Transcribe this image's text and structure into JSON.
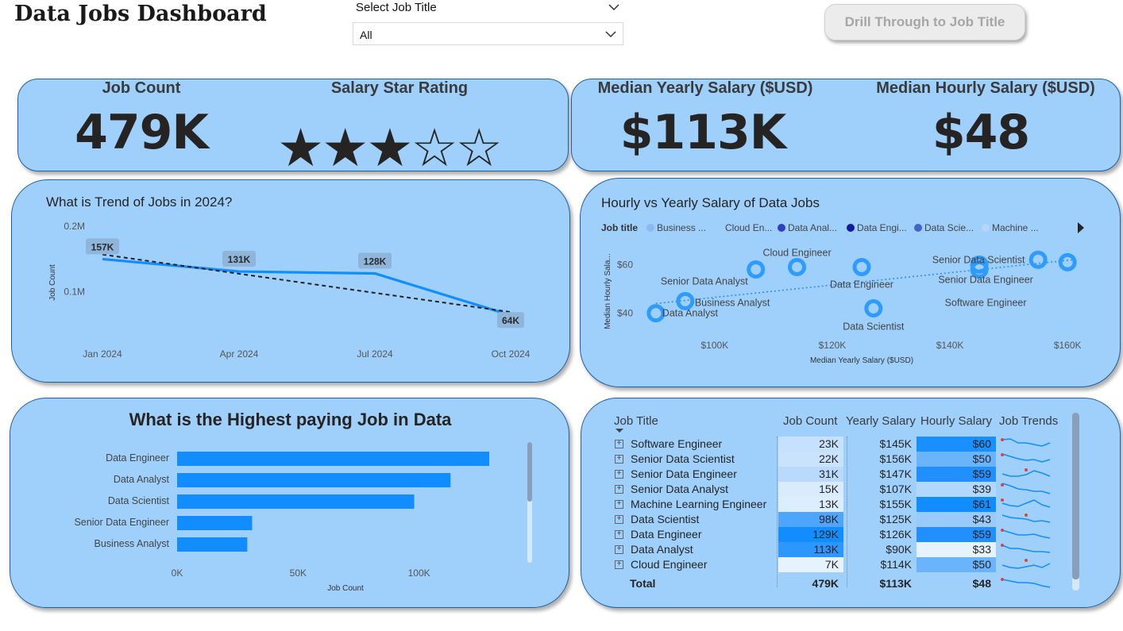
{
  "page": {
    "title": "Data Jobs Dashboard"
  },
  "slicer": {
    "label": "Select Job Title",
    "value": "All"
  },
  "drill_button": {
    "label": "Drill Through to Job Title"
  },
  "kpis": {
    "job_count": {
      "label": "Job Count",
      "value": "479K"
    },
    "star_rating": {
      "label": "Salary Star Rating",
      "stars": "★★★☆☆",
      "rating": 3,
      "max": 5
    },
    "median_yearly": {
      "label": "Median Yearly Salary ($USD)",
      "value": "$113K"
    },
    "median_hourly": {
      "label": "Median Hourly Salary ($USD)",
      "value": "$48"
    }
  },
  "trend_card": {
    "title": "What is Trend of Jobs in 2024?"
  },
  "scatter_card": {
    "title": "Hourly vs Yearly Salary of Data Jobs"
  },
  "bar_card": {
    "title": "What is the Highest paying Job in Data"
  },
  "chart_data": [
    {
      "type": "line",
      "x": [
        "Jan 2024",
        "Apr 2024",
        "Jul 2024",
        "Oct 2024"
      ],
      "series": [
        {
          "values": [
            150,
            131,
            128,
            64
          ]
        }
      ],
      "data_labels": [
        "157K",
        "131K",
        "128K",
        "64K"
      ],
      "trend_line": {
        "start": 157,
        "end": 69,
        "style": "dashed"
      },
      "ylabel": "Job Count",
      "yticks": [
        {
          "v": 200,
          "label": "0.2M"
        },
        {
          "v": 100,
          "label": "0.1M"
        }
      ],
      "ylim": [
        40,
        210
      ],
      "color": "#118dff"
    },
    {
      "type": "scatter",
      "legend_title": "Job title",
      "legend": [
        {
          "name": "Business ...",
          "color": "#8fb8f2"
        },
        {
          "name": "Cloud En...",
          "color": "#9fd0fb"
        },
        {
          "name": "Data Anal...",
          "color": "#2e3fc2"
        },
        {
          "name": "Data Engi...",
          "color": "#0d1aa3"
        },
        {
          "name": "Data Scie...",
          "color": "#4661c9"
        },
        {
          "name": "Machine ...",
          "color": "#b6d6f7"
        }
      ],
      "points": [
        {
          "name": "Data Analyst",
          "x": 90,
          "y": 40
        },
        {
          "name": "Business Analyst",
          "x": 95,
          "y": 45
        },
        {
          "name": "Senior Data Analyst",
          "x": 107,
          "y": 58
        },
        {
          "name": "Cloud Engineer",
          "x": 114,
          "y": 59
        },
        {
          "name": "Data Engineer",
          "x": 125,
          "y": 59
        },
        {
          "name": "Data Scientist",
          "x": 127,
          "y": 42
        },
        {
          "name": "Software Engineer",
          "x": 145,
          "y": 58
        },
        {
          "name": "Senior Data Engineer",
          "x": 145,
          "y": 60
        },
        {
          "name": "Senior Data Scientist",
          "x": 155,
          "y": 62
        },
        {
          "name": "",
          "x": 160,
          "y": 61
        }
      ],
      "trend_line": {
        "from": [
          90,
          44
        ],
        "to": [
          161,
          62
        ],
        "style": "dotted"
      },
      "xlabel": "Median Yearly Salary ($USD)",
      "ylabel": "Median Hourly Sala...",
      "xticks": [
        {
          "v": 100,
          "label": "$100K"
        },
        {
          "v": 120,
          "label": "$120K"
        },
        {
          "v": 140,
          "label": "$140K"
        },
        {
          "v": 160,
          "label": "$160K"
        }
      ],
      "yticks": [
        {
          "v": 60,
          "label": "$60"
        },
        {
          "v": 40,
          "label": "$40"
        }
      ],
      "xlim": [
        88,
        162
      ],
      "ylim": [
        35,
        66
      ]
    },
    {
      "type": "bar",
      "orientation": "horizontal",
      "categories": [
        "Data Engineer",
        "Data Analyst",
        "Data Scientist",
        "Senior Data Engineer",
        "Business Analyst"
      ],
      "values": [
        129,
        113,
        98,
        31,
        29
      ],
      "xlabel": "Job Count",
      "xticks": [
        {
          "v": 0,
          "label": "0K"
        },
        {
          "v": 50,
          "label": "50K"
        },
        {
          "v": 100,
          "label": "100K"
        }
      ],
      "xlim": [
        0,
        140
      ],
      "color": "#118dff"
    }
  ],
  "table": {
    "columns": [
      "Job Title",
      "Job Count",
      "Yearly Salary",
      "Hourly Salary",
      "Job Trends"
    ],
    "rows": [
      {
        "title": "Software Engineer",
        "count": "23K",
        "yearly": "$145K",
        "hourly": "$60",
        "countBg": "#c6e1fd",
        "hourlyBg": "#1a8fff"
      },
      {
        "title": "Senior Data Scientist",
        "count": "22K",
        "yearly": "$156K",
        "hourly": "$50",
        "countBg": "#c9e3fd",
        "hourlyBg": "#6ab4fc"
      },
      {
        "title": "Senior Data Engineer",
        "count": "31K",
        "yearly": "$147K",
        "hourly": "$59",
        "countBg": "#b9dafd",
        "hourlyBg": "#228fff"
      },
      {
        "title": "Senior Data Analyst",
        "count": "15K",
        "yearly": "$107K",
        "hourly": "$39",
        "countBg": "#d9ebfd",
        "hourlyBg": "#b3d8fd"
      },
      {
        "title": "Machine Learning Engineer",
        "count": "13K",
        "yearly": "$155K",
        "hourly": "$61",
        "countBg": "#dcedfd",
        "hourlyBg": "#118dff"
      },
      {
        "title": "Data Scientist",
        "count": "98K",
        "yearly": "$125K",
        "hourly": "$43",
        "countBg": "#4ea5fd",
        "hourlyBg": "#98cbfc"
      },
      {
        "title": "Data Engineer",
        "count": "129K",
        "yearly": "$126K",
        "hourly": "$59",
        "countBg": "#118dff",
        "hourlyBg": "#228fff"
      },
      {
        "title": "Data Analyst",
        "count": "113K",
        "yearly": "$90K",
        "hourly": "$33",
        "countBg": "#2c98ff",
        "hourlyBg": "#e6f2fd"
      },
      {
        "title": "Cloud Engineer",
        "count": "7K",
        "yearly": "$114K",
        "hourly": "$50",
        "countBg": "#e6f2fd",
        "hourlyBg": "#6ab4fc"
      }
    ],
    "total": {
      "label": "Total",
      "count": "479K",
      "yearly": "$113K",
      "hourly": "$48"
    }
  }
}
